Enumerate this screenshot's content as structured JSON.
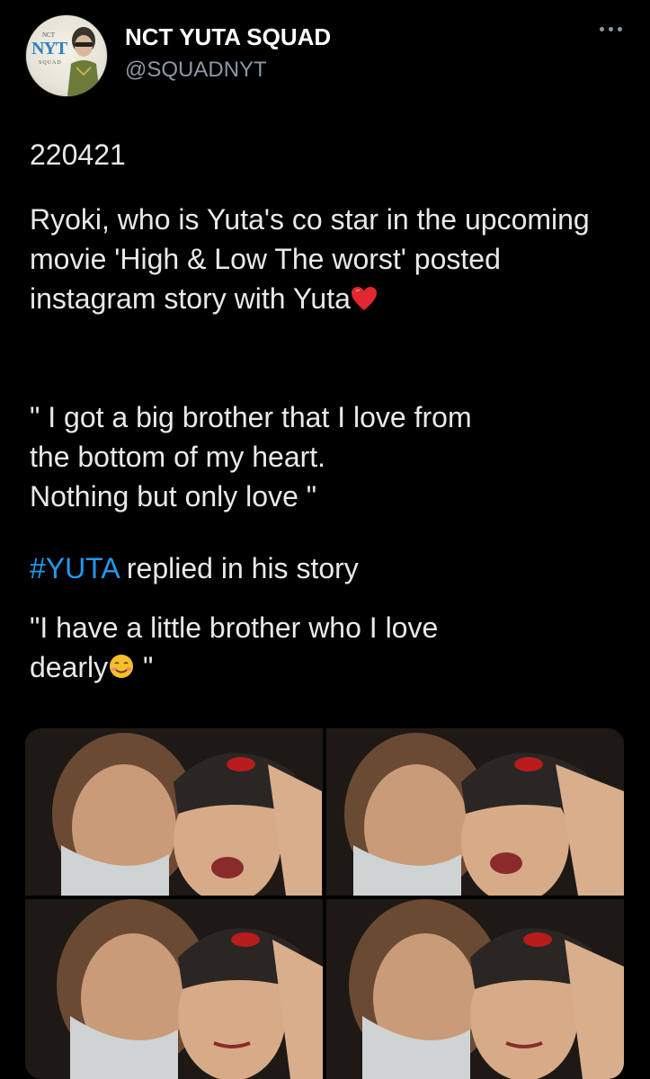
{
  "account": {
    "name": "NCT YUTA SQUAD",
    "handle": "@SQUADNYT",
    "avatar_logo": "NYT",
    "avatar_logo_top": "NCT",
    "avatar_logo_bottom": "SQUAD"
  },
  "tweet": {
    "date_line": "220421",
    "para1": "Ryoki, who is Yuta's co star in the upcoming movie 'High & Low The worst' posted instagram story with Yuta",
    "quote1_line1": "\" I got a big brother that I love from",
    "quote1_line2": "the bottom of my heart.",
    "quote1_line3": "Nothing but only love \"",
    "hashtag": "#YUTA",
    "hashtag_rest": " replied in his story",
    "quote2_line1": "\"I have a little brother who I love",
    "quote2_line2": "dearly",
    "quote2_close": " \""
  },
  "icons": {
    "more": "more-horizontal-icon",
    "heart": "red-heart-emoji",
    "smile": "smiling-face-emoji"
  },
  "colors": {
    "background": "#000000",
    "text": "#e7e9ea",
    "secondary": "#8b98a5",
    "link": "#1d9bf0"
  },
  "media": {
    "count": 4,
    "description": "four-photo grid"
  }
}
